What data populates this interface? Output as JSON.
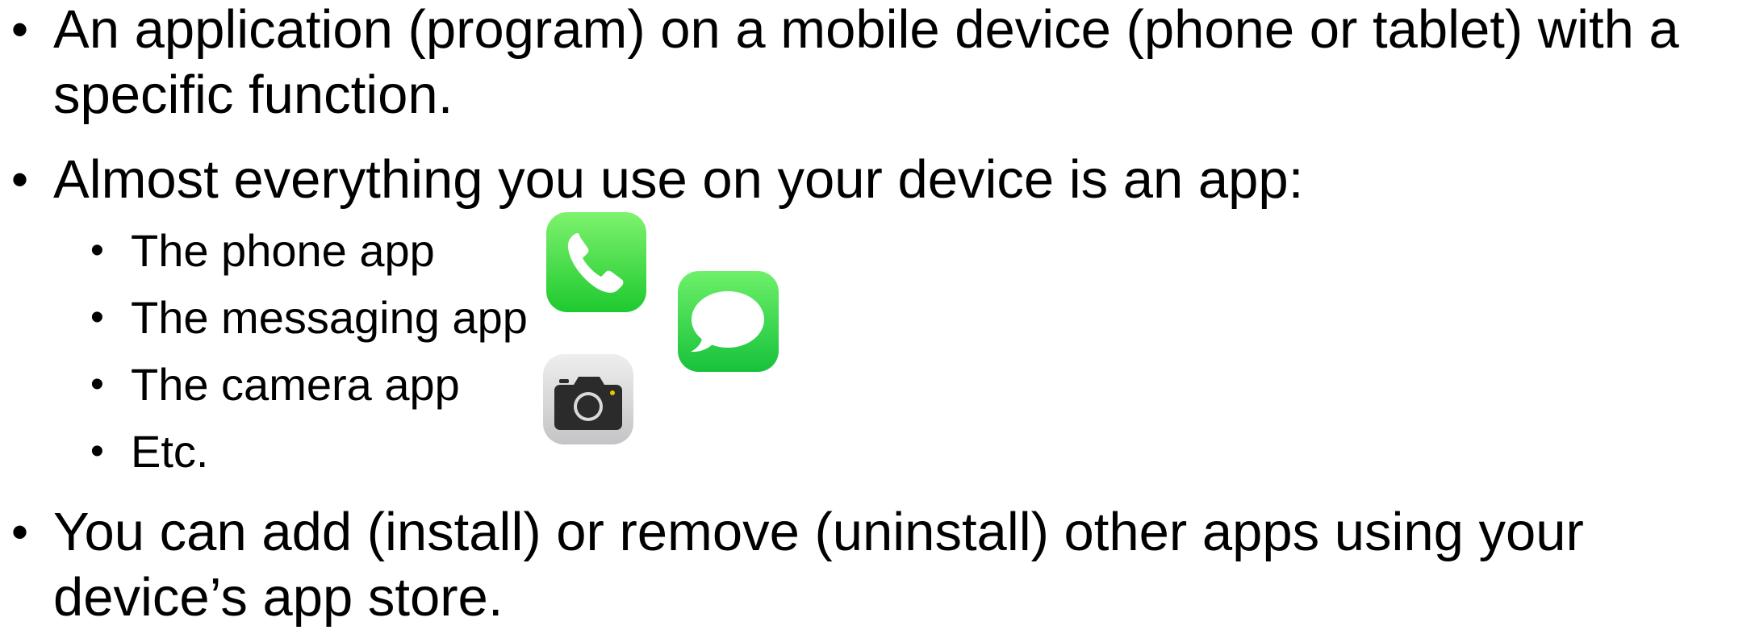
{
  "bullets": [
    {
      "lines": [
        "An application (program) on a mobile device (phone or tablet) with a",
        "specific function."
      ]
    },
    {
      "lines": [
        "Almost everything you use on your device is an app:"
      ]
    },
    {
      "lines": [
        "You can add (install) or remove (uninstall) other apps using your",
        "device’s app store."
      ]
    }
  ],
  "sub_bullets": [
    "The phone app",
    "The messaging app",
    "The camera app",
    "Etc."
  ],
  "icons": {
    "phone": "phone-app-icon",
    "messages": "messages-app-icon",
    "camera": "camera-app-icon"
  },
  "colors": {
    "phone_green_top": "#7ef36e",
    "phone_green_bottom": "#1ec92f",
    "messages_green_top": "#6ef06a",
    "messages_green_bottom": "#16c23a",
    "camera_gray_top": "#eeeeee",
    "camera_gray_bottom": "#c4c4c6",
    "camera_body": "#2b2b2b"
  }
}
